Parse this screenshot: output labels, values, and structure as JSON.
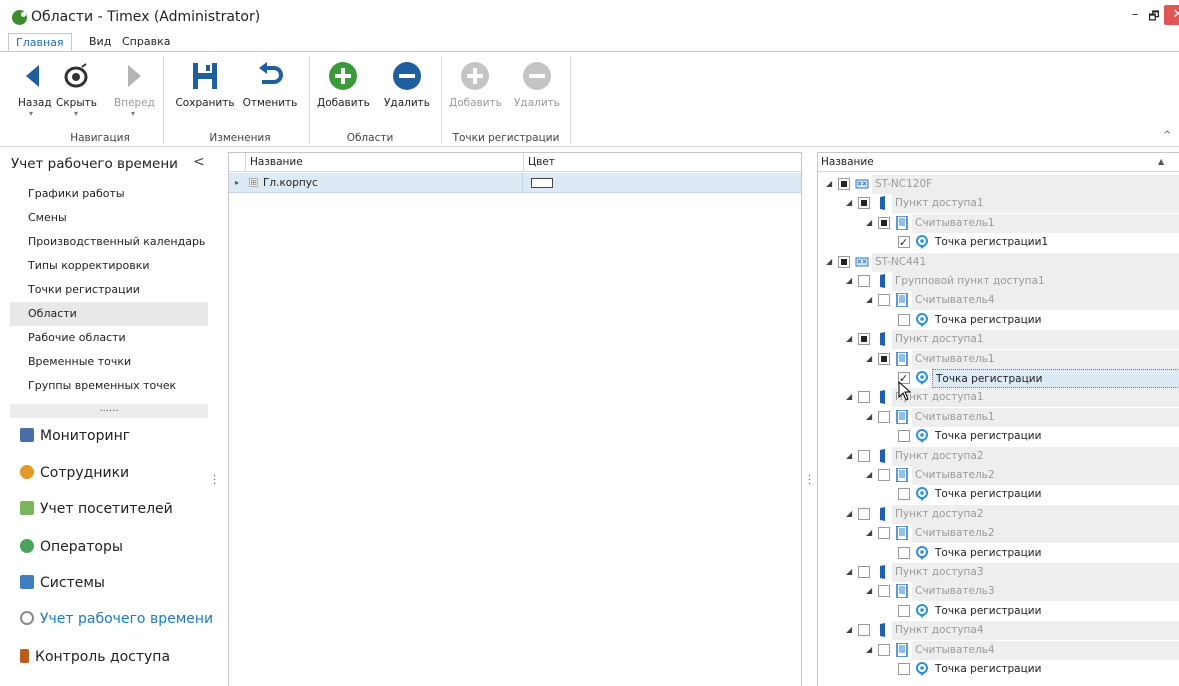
{
  "window": {
    "title": "Области - Timex (Administrator)",
    "minimize": "–",
    "maximize": "🗗",
    "close": "✕"
  },
  "menu": {
    "tabs": [
      "Главная",
      "Вид",
      "Справка"
    ]
  },
  "ribbon": {
    "buttons": {
      "back": "Назад",
      "hide": "Скрыть",
      "forward": "Вперед",
      "save": "Сохранить",
      "cancel": "Отменить",
      "add_area": "Добавить",
      "delete_area": "Удалить",
      "add_point": "Добавить",
      "delete_point": "Удалить"
    },
    "dropdown_marker": "▾",
    "groups": [
      "Навигация",
      "Изменения",
      "Области",
      "Точки регистрации"
    ],
    "collapse": "^"
  },
  "left_pane": {
    "title": "Учет рабочего времени",
    "collapse": "<",
    "items": [
      "Графики работы",
      "Смены",
      "Производственный календарь",
      "Типы корректировки",
      "Точки регистрации",
      "Области",
      "Рабочие области",
      "Временные точки",
      "Группы временных точек"
    ],
    "more": "......",
    "modules": [
      "Мониторинг",
      "Сотрудники",
      "Учет посетителей",
      "Операторы",
      "Системы",
      "Учет рабочего времени",
      "Контроль доступа"
    ]
  },
  "grid": {
    "columns": [
      "Название",
      "Цвет"
    ],
    "rows": [
      {
        "name": "Гл.корпус",
        "expand": "⊞",
        "indicator": "▸"
      }
    ]
  },
  "tree": {
    "header": "Название",
    "sort": "▲",
    "nodes": [
      {
        "label": "ST-NC120F"
      },
      {
        "label": "Пункт доступа1"
      },
      {
        "label": "Считыватель1"
      },
      {
        "label": "Точка регистрации1"
      },
      {
        "label": "ST-NC441"
      },
      {
        "label": "Групповой пункт доступа1"
      },
      {
        "label": "Считыватель4"
      },
      {
        "label": "Точка регистрации"
      },
      {
        "label": "Пункт доступа1"
      },
      {
        "label": "Считыватель1"
      },
      {
        "label": "Точка регистрации"
      },
      {
        "label": "Пункт доступа1"
      },
      {
        "label": "Считыватель1"
      },
      {
        "label": "Точка регистрации"
      },
      {
        "label": "Пункт доступа2"
      },
      {
        "label": "Считыватель2"
      },
      {
        "label": "Точка регистрации"
      },
      {
        "label": "Пункт доступа2"
      },
      {
        "label": "Считыватель2"
      },
      {
        "label": "Точка регистрации"
      },
      {
        "label": "Пункт доступа3"
      },
      {
        "label": "Считыватель3"
      },
      {
        "label": "Точка регистрации"
      },
      {
        "label": "Пункт доступа4"
      },
      {
        "label": "Считыватель4"
      },
      {
        "label": "Точка регистрации"
      }
    ]
  },
  "colors": {
    "accent": "#1f6fb3",
    "selection": "#dde9f5",
    "add_green": "#3c9a3c",
    "delete_blue": "#1f5f9e"
  }
}
